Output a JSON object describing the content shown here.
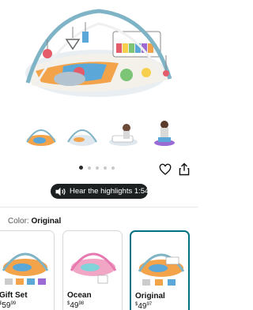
{
  "product_gallery": {
    "dot_count": 5,
    "active_dot_index": 0,
    "icons": {
      "save": "heart-icon",
      "share": "share-icon"
    }
  },
  "audio_button": {
    "label": "Hear the highlights 1:54",
    "icon": "speaker-sound-icon",
    "colors": {
      "background": "#1c2021",
      "text": "#ffffff"
    }
  },
  "color_selector": {
    "label": "Color:",
    "selected_value": "Original",
    "options": [
      {
        "name": "Gift Set",
        "price_currency": "$",
        "price_whole": "59",
        "price_fraction": "99",
        "selected": false
      },
      {
        "name": "Ocean",
        "price_currency": "$",
        "price_whole": "49",
        "price_fraction": "98",
        "selected": false
      },
      {
        "name": "Original",
        "price_currency": "$",
        "price_whole": "49",
        "price_fraction": "97",
        "selected": true
      }
    ],
    "selected_border_color": "#007185"
  }
}
